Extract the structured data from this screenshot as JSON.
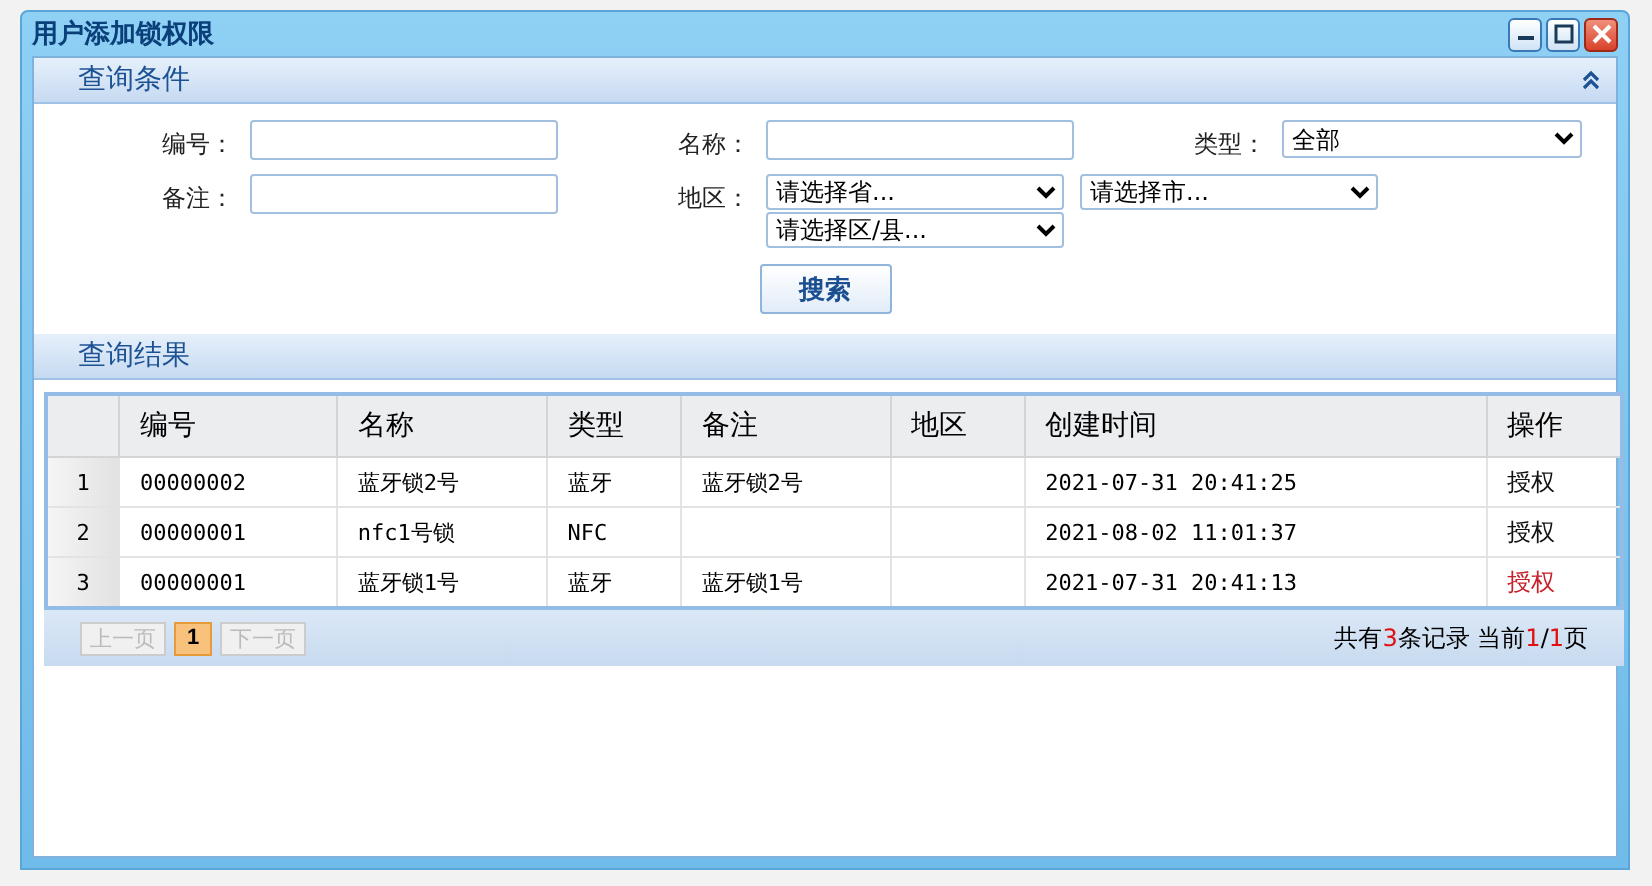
{
  "window": {
    "title": "用户添加锁权限",
    "controls": [
      {
        "kind": "minimize"
      },
      {
        "kind": "maximize"
      },
      {
        "kind": "close"
      }
    ]
  },
  "query_panel": {
    "title": "查询条件",
    "expanded": true,
    "fields": [
      {
        "kind": "text",
        "label": "编号："
      },
      {
        "kind": "text",
        "label": "名称："
      },
      {
        "kind": "select",
        "label": "类型：",
        "options": [
          "全部"
        ]
      },
      {
        "kind": "text",
        "label": "备注："
      },
      {
        "kind": "select",
        "label": "地区：",
        "options": [
          "请选择省...",
          "请选择市...",
          "请选择区/县..."
        ]
      }
    ],
    "search_button": "搜索"
  },
  "results_panel": {
    "title": "查询结果",
    "table": {
      "columns": [
        "编号",
        "名称",
        "类型",
        "备注",
        "地区",
        "创建时间",
        "操作"
      ],
      "rows": [
        {
          "index": "1",
          "cells": [
            "00000002",
            "蓝牙锁2号",
            "蓝牙",
            "蓝牙锁2号",
            "",
            "2021-07-31 20:41:25"
          ],
          "action": "授权",
          "highlighted": false
        },
        {
          "index": "2",
          "cells": [
            "00000001",
            "nfc1号锁",
            "NFC",
            "",
            "",
            "2021-08-02 11:01:37"
          ],
          "action": "授权",
          "highlighted": false
        },
        {
          "index": "3",
          "cells": [
            "00000001",
            "蓝牙锁1号",
            "蓝牙",
            "蓝牙锁1号",
            "",
            "2021-07-31 20:41:13"
          ],
          "action": "授权",
          "highlighted": true
        }
      ]
    },
    "pager": {
      "prev": {
        "label": "上一页",
        "disabled": true
      },
      "pages": [
        {
          "label": "1",
          "selected": true
        }
      ],
      "next": {
        "label": "下一页",
        "disabled": true
      },
      "summary": [
        {
          "text": "共有",
          "emphasis": false
        },
        {
          "text": "3",
          "emphasis": true
        },
        {
          "text": "条记录 当前",
          "emphasis": false
        },
        {
          "text": "1",
          "emphasis": true
        },
        {
          "text": "/",
          "emphasis": false
        },
        {
          "text": "1",
          "emphasis": true
        },
        {
          "text": "页",
          "emphasis": false
        }
      ]
    }
  }
}
